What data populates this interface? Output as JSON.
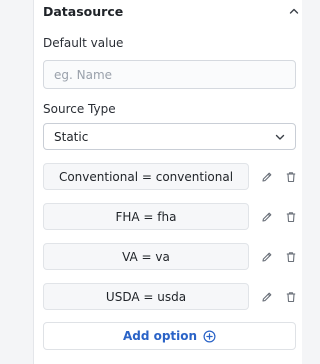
{
  "datasource": {
    "title": "Datasource",
    "collapse_icon": "chevron-up-icon"
  },
  "default_value": {
    "label": "Default value",
    "placeholder": "eg. Name",
    "value": ""
  },
  "source_type": {
    "label": "Source Type",
    "selected": "Static",
    "icon": "chevron-down-icon"
  },
  "options": [
    {
      "label": "Conventional = conventional"
    },
    {
      "label": "FHA = fha"
    },
    {
      "label": "VA = va"
    },
    {
      "label": "USDA = usda"
    }
  ],
  "option_icons": {
    "edit": "pencil-icon",
    "delete": "trash-icon"
  },
  "add_option": {
    "label": "Add option",
    "icon": "plus-circle-icon",
    "accent_color": "#2a63c7"
  }
}
